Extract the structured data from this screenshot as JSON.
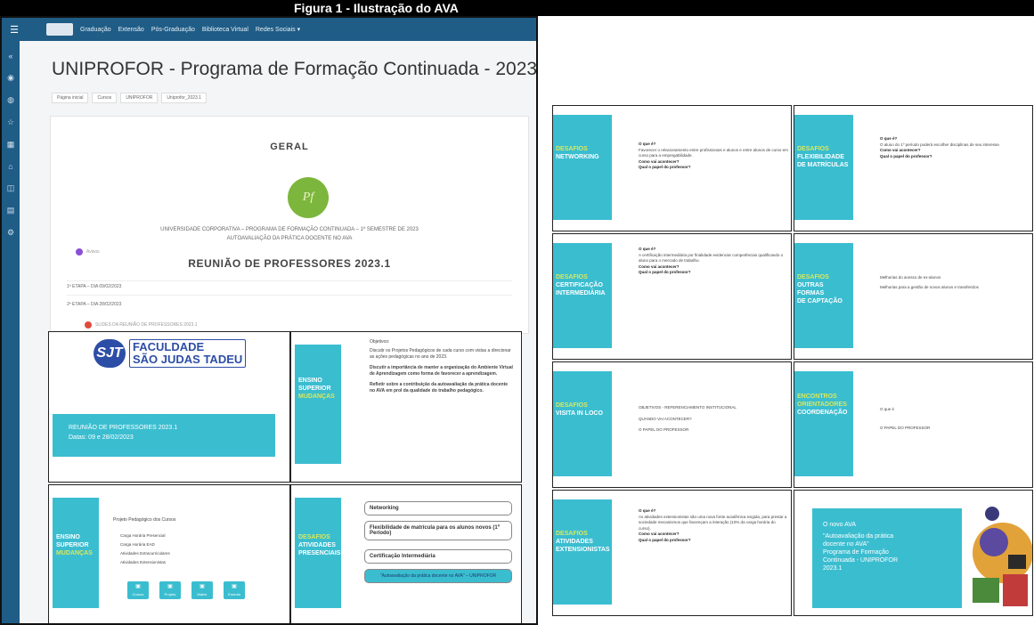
{
  "caption": "Figura 1 - Ilustração do AVA",
  "navbar": {
    "items": [
      "Graduação",
      "Extensão",
      "Pós-Graduação",
      "Biblioteca Virtual",
      "Redes Sociais ▾"
    ]
  },
  "page": {
    "title": "UNIPROFOR - Programa de Formação Continuada - 2023.1",
    "breadcrumb": [
      "Página inicial",
      "Cursos",
      "UNIPROFOR",
      "Uniprofor_2023.1"
    ],
    "geral": "GERAL",
    "logo_text": "Pf",
    "university_line1": "UNIVERSIDADE CORPORATIVA – PROGRAMA DE FORMAÇÃO CONTINUADA – 1º SEMESTRE DE 2023",
    "university_line2": "AUTOAVALIAÇÃO DA PRÁTICA DOCENTE NO AVA",
    "aviso": "Avisos",
    "reuniao": "REUNIÃO DE PROFESSORES 2023.1",
    "etapa1": "1ª ETAPA – DIA 09/02/2023",
    "etapa2": "2ª ETAPA – DIA 28/02/2023",
    "slides_link": "SLIDES DA REUNIÃO DE PROFESSORES 2023.1"
  },
  "slide1": {
    "logo_mark": "SJT",
    "logo_line1": "FACULDADE",
    "logo_line2": "SÃO JUDAS TADEU",
    "box_line1": "REUNIÃO DE PROFESSORES 2023.1",
    "box_line2": "Datas: 09 e 28/02/2023"
  },
  "slide2": {
    "panel_line1": "ENSINO",
    "panel_line2": "SUPERIOR",
    "panel_line3": "MUDANÇAS",
    "objectives": "Objetivos:",
    "obj1": "Discutir os Projetos Pedagógicos de cada curso com vistas a direcionar as ações pedagógicas no ano de 2023.",
    "obj2": "Discutir a importância de manter a organização do Ambiente Virtual de Aprendizagem como forma de favorecer a aprendizagem.",
    "obj3": "Refletir sobre a contribuição da autoavaliação da prática docente no AVA em prol da qualidade do trabalho pedagógico."
  },
  "slide3": {
    "panel_line1": "ENSINO",
    "panel_line2": "SUPERIOR",
    "panel_line3": "MUDANÇAS",
    "heading": "Projeto Pedagógico dos Cursos",
    "items": [
      "Carga Horária Presencial",
      "Carga Horária EAD",
      "Atividades Extracurriculares",
      "Atividades Extensionistas"
    ],
    "buttons": [
      "Cursos",
      "Projeto",
      "Matriz",
      "Ementa"
    ]
  },
  "slide4": {
    "panel_line1": "DESAFIOS",
    "panel_line2": "ATIVIDADES",
    "panel_line3": "PRESENCIAIS",
    "pill1": "Networking",
    "pill2": "Flexibilidade de matrícula para os alunos novos (1º Período)",
    "pill3": "Certificação Intermediária",
    "pill4": "\"Autoavaliação da prática docente no AVA\" – UNIPROFOR"
  },
  "rslides": [
    {
      "p1": "DESAFIOS",
      "p2": "NETWORKING",
      "p3": "",
      "q1": "O que é?",
      "t1": "Favorecer o relacionamento entre profissionais e alunos e entre alunos de curso em curso para a empregabilidade.",
      "q2": "Como vai acontecer?",
      "q3": "Qual o papel do professor?"
    },
    {
      "p1": "DESAFIOS",
      "p2": "FLEXIBILIDADE",
      "p3": "DE MATRÍCULAS",
      "q1": "O que é?",
      "t1": "O aluno do 1º período poderá escolher disciplinas de seu interesse.",
      "q2": "Como vai acontecer?",
      "q3": "Qual o papel do professor?"
    },
    {
      "p1": "DESAFIOS",
      "p2": "CERTIFICAÇÃO",
      "p3": "INTERMEDIÁRIA",
      "q1": "O que é?",
      "t1": "A certificação intermediária por finalidade evidenciar competências qualificando o aluno para o mercado de trabalho.",
      "q2": "Como vai acontecer?",
      "q3": "Qual o papel do professor?"
    },
    {
      "p1": "DESAFIOS",
      "p2": "OUTRAS FORMAS",
      "p3": "DE CAPTAÇÃO",
      "q1": "",
      "t1": "Melhorias do acesso de ex-alunos",
      "q2": "Melhorias para a gestão de novos alunos e transferidos",
      "q3": ""
    },
    {
      "p1": "DESAFIOS",
      "p2": "VISITA IN LOCO",
      "p3": "",
      "q1": "",
      "t1": "OBJETIVOS - REFERENCIAMENTO INSTITUCIONAL",
      "q2": "QUANDO VAI ACONTECER?",
      "q3": "O PAPEL DO PROFESSOR"
    },
    {
      "p1": "ENCONTROS",
      "p2": "ORIENTADORES",
      "p3": "COORDENAÇÃO",
      "q1": "",
      "t1": "O que é",
      "q2": "",
      "q3": "O PAPEL DO PROFESSOR"
    },
    {
      "p1": "DESAFIOS",
      "p2": "ATIVIDADES",
      "p3": "EXTENSIONISTAS",
      "q1": "O que é?",
      "t1": "As atividades extensionistas são uma nova fonte acadêmica exigida, para prestar a sociedade mecanismos que favoreçam a interação (10% da carga horária do curso).",
      "q2": "Como vai acontecer?",
      "q3": "Qual o papel do professor?"
    }
  ],
  "final_slide": {
    "line1": "O novo AVA",
    "line2": "\"Autoavaliação da prática",
    "line3": "docente no AVA\"",
    "line4": "Programa de Formação",
    "line5": "Continuada - UNIPROFOR",
    "line6": "2023.1"
  }
}
